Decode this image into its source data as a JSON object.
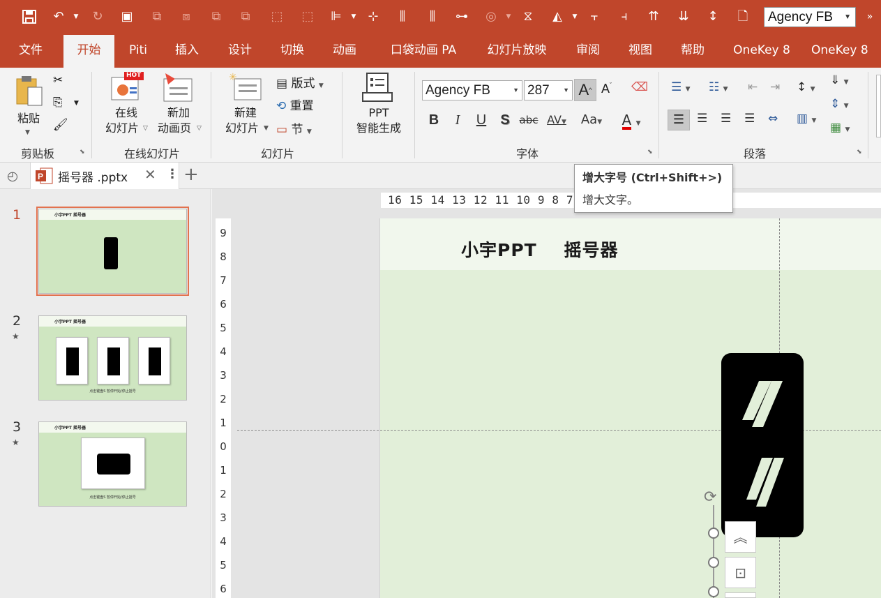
{
  "quick_access": {
    "font_name": "Agency FB"
  },
  "menu_tabs": [
    {
      "label": "文件"
    },
    {
      "label": "开始"
    },
    {
      "label": "Piti"
    },
    {
      "label": "插入"
    },
    {
      "label": "设计"
    },
    {
      "label": "切换"
    },
    {
      "label": "动画"
    },
    {
      "label": "口袋动画 PA"
    },
    {
      "label": "幻灯片放映"
    },
    {
      "label": "审阅"
    },
    {
      "label": "视图"
    },
    {
      "label": "帮助"
    },
    {
      "label": "OneKey 8"
    },
    {
      "label": "OneKey 8"
    }
  ],
  "ribbon": {
    "clipboard": {
      "group_label": "剪贴板",
      "paste_label": "粘贴"
    },
    "online_slides": {
      "group_label": "在线幻灯片",
      "online_line1": "在线",
      "online_line2": "幻灯片",
      "hot_badge": "HOT",
      "anim_line1": "新加",
      "anim_line2": "动画页"
    },
    "slides": {
      "group_label": "幻灯片",
      "new_line1": "新建",
      "new_line2": "幻灯片",
      "layout": "版式",
      "reset": "重置",
      "section": "节"
    },
    "ppt_gen": {
      "line1": "PPT",
      "line2": "智能生成"
    },
    "font": {
      "group_label": "字体",
      "font_name": "Agency FB",
      "font_size": "287",
      "bold": "B",
      "italic": "I",
      "underline": "U",
      "shadow": "S",
      "strike": "abc",
      "spacing": "AV",
      "case": "Aa",
      "color_letter": "A",
      "grow_letter": "A",
      "shrink_letter": "A"
    },
    "paragraph": {
      "group_label": "段落"
    }
  },
  "document_tab": {
    "filename": "摇号器 .pptx"
  },
  "tooltip": {
    "title": "增大字号 (Ctrl+Shift+>)",
    "description": "增大文字。"
  },
  "thumbnails": [
    {
      "number": "1",
      "title": "小宇PPT   摇号器"
    },
    {
      "number": "2",
      "title": "小宇PPT   摇号器",
      "caption": "点击键盘S 暂停开始/停止摇号"
    },
    {
      "number": "3",
      "title": "小宇PPT   摇号器",
      "caption": "点击键盘S 暂停开始/停止摇号"
    }
  ],
  "rulers": {
    "horizontal": "16 15 14 13 12 11 10 9 8 7 6 5 4 3 2 1 0 1 2 3 4",
    "vertical": [
      "9",
      "8",
      "7",
      "6",
      "5",
      "4",
      "3",
      "2",
      "1",
      "0",
      "1",
      "2",
      "3",
      "4",
      "5",
      "6"
    ]
  },
  "slide": {
    "title": "小宇PPT    摇号器"
  },
  "colors": {
    "accent": "#c0462b",
    "slide_bg": "#e2efd9",
    "selection_outline": "#e2724f"
  }
}
